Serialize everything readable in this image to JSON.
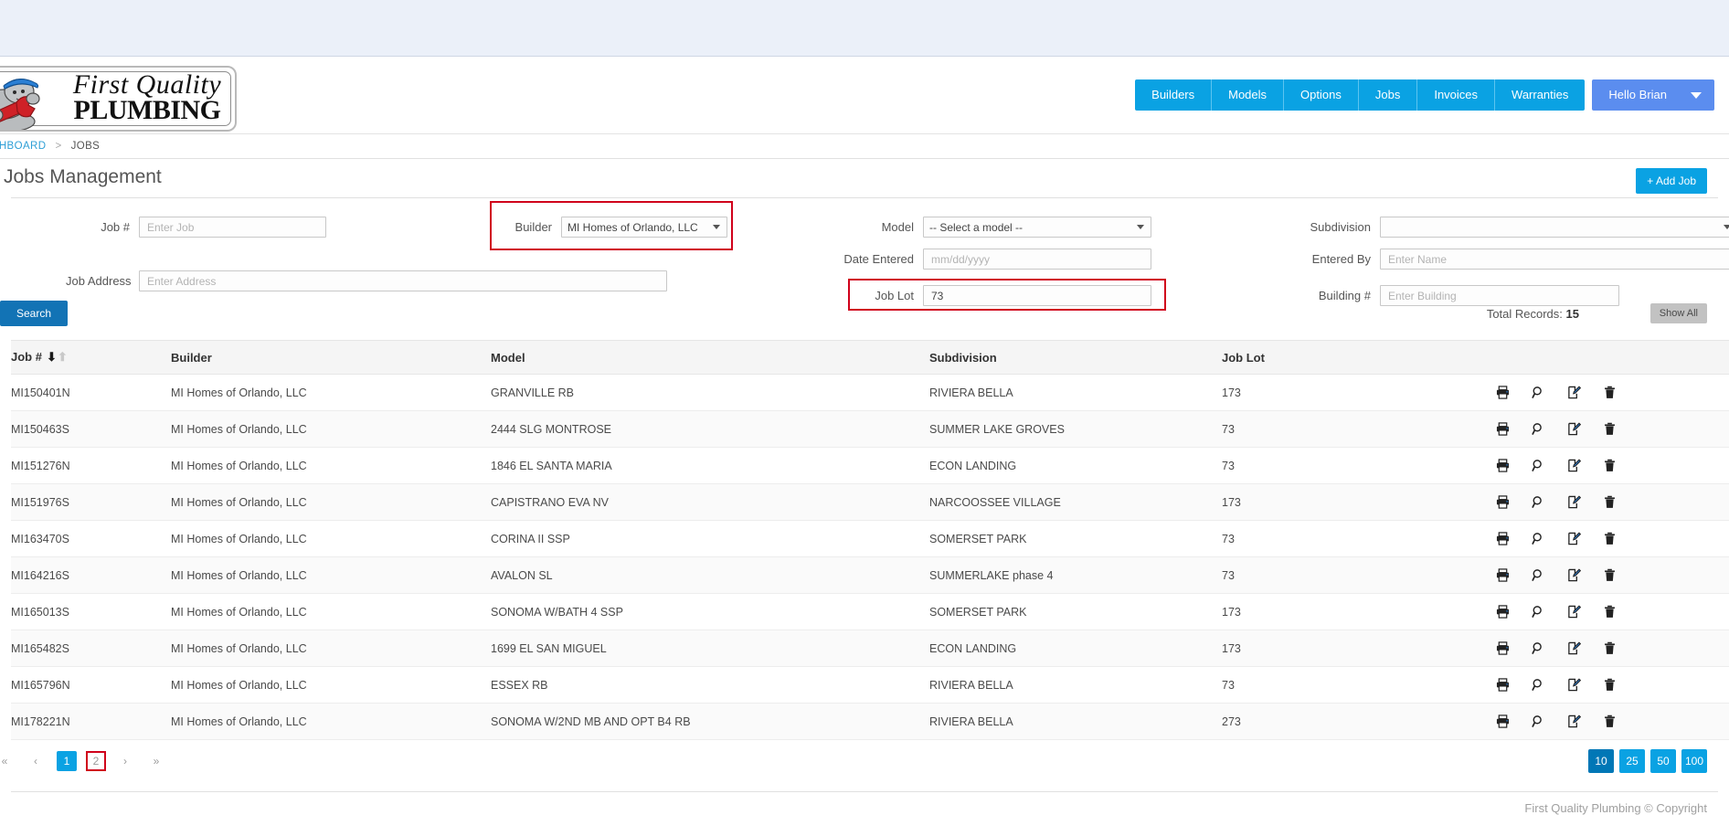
{
  "header": {
    "logo": {
      "line1": "First Quality",
      "line2": "PLUMBING",
      "mascot_icon": "plumber-mascot-icon"
    },
    "nav_items": [
      {
        "label": "Builders"
      },
      {
        "label": "Models"
      },
      {
        "label": "Options"
      },
      {
        "label": "Jobs"
      },
      {
        "label": "Invoices"
      },
      {
        "label": "Warranties"
      }
    ],
    "user_menu": {
      "label": "Hello Brian",
      "caret_icon": "chevron-down-icon"
    }
  },
  "breadcrumb": {
    "home": "DASHBOARD",
    "separator": ">",
    "current": "JOBS"
  },
  "page": {
    "title": "Jobs Management",
    "add_button": "+ Add Job"
  },
  "search_form": {
    "job_number": {
      "label": "Job #",
      "placeholder": "Enter Job",
      "value": ""
    },
    "job_address": {
      "label": "Job Address",
      "placeholder": "Enter Address",
      "value": ""
    },
    "builder": {
      "label": "Builder",
      "value": "MI Homes of Orlando, LLC",
      "highlighted": true
    },
    "model": {
      "label": "Model",
      "value": "-- Select a model --"
    },
    "date_entered": {
      "label": "Date Entered",
      "placeholder": "mm/dd/yyyy",
      "value": ""
    },
    "job_lot": {
      "label": "Job Lot",
      "value": "73",
      "highlighted": true
    },
    "subdivision": {
      "label": "Subdivision",
      "value": ""
    },
    "entered_by": {
      "label": "Entered By",
      "placeholder": "Enter Name",
      "value": ""
    },
    "building_number": {
      "label": "Building #",
      "placeholder": "Enter Building",
      "value": ""
    },
    "search_button": "Search"
  },
  "results": {
    "total_records_label": "Total Records:",
    "total_records_value": "15",
    "show_all_button": "Show All",
    "columns": [
      "Job #",
      "Builder",
      "Model",
      "Subdivision",
      "Job Lot"
    ],
    "sort_column": "Job #",
    "rows": [
      {
        "job": "MI150401N",
        "builder": "MI Homes of Orlando, LLC",
        "model": "GRANVILLE RB",
        "subdivision": "RIVIERA BELLA",
        "lot": "173"
      },
      {
        "job": "MI150463S",
        "builder": "MI Homes of Orlando, LLC",
        "model": "2444 SLG MONTROSE",
        "subdivision": "SUMMER LAKE GROVES",
        "lot": "73"
      },
      {
        "job": "MI151276N",
        "builder": "MI Homes of Orlando, LLC",
        "model": "1846 EL SANTA MARIA",
        "subdivision": "ECON LANDING",
        "lot": "73"
      },
      {
        "job": "MI151976S",
        "builder": "MI Homes of Orlando, LLC",
        "model": "CAPISTRANO EVA NV",
        "subdivision": "NARCOOSSEE VILLAGE",
        "lot": "173"
      },
      {
        "job": "MI163470S",
        "builder": "MI Homes of Orlando, LLC",
        "model": "CORINA II SSP",
        "subdivision": "SOMERSET PARK",
        "lot": "73"
      },
      {
        "job": "MI164216S",
        "builder": "MI Homes of Orlando, LLC",
        "model": "AVALON SL",
        "subdivision": "SUMMERLAKE phase 4",
        "lot": "73"
      },
      {
        "job": "MI165013S",
        "builder": "MI Homes of Orlando, LLC",
        "model": "SONOMA W/BATH 4 SSP",
        "subdivision": "SOMERSET PARK",
        "lot": "173"
      },
      {
        "job": "MI165482S",
        "builder": "MI Homes of Orlando, LLC",
        "model": "1699 EL SAN MIGUEL",
        "subdivision": "ECON LANDING",
        "lot": "173"
      },
      {
        "job": "MI165796N",
        "builder": "MI Homes of Orlando, LLC",
        "model": "ESSEX RB",
        "subdivision": "RIVIERA BELLA",
        "lot": "73"
      },
      {
        "job": "MI178221N",
        "builder": "MI Homes of Orlando, LLC",
        "model": "SONOMA W/2ND MB AND OPT B4 RB",
        "subdivision": "RIVIERA BELLA",
        "lot": "273"
      }
    ],
    "row_actions": [
      "print-icon",
      "view-icon",
      "edit-icon",
      "delete-icon"
    ]
  },
  "pagination": {
    "first": "«",
    "prev": "‹",
    "pages": [
      "1",
      "2"
    ],
    "active_page": "1",
    "marked_page": "2",
    "next": "›",
    "last": "»",
    "page_sizes": [
      "10",
      "25",
      "50",
      "100"
    ],
    "active_page_size": "10"
  },
  "footer": {
    "copyright": "First Quality Plumbing © Copyright"
  },
  "colors": {
    "nav_blue": "#0aa2e3",
    "user_blue": "#5b8def",
    "search_blue": "#1273b5",
    "active_page_size": "#0077b6",
    "highlight_red": "#d0021b",
    "top_band": "#ebf0f9"
  }
}
